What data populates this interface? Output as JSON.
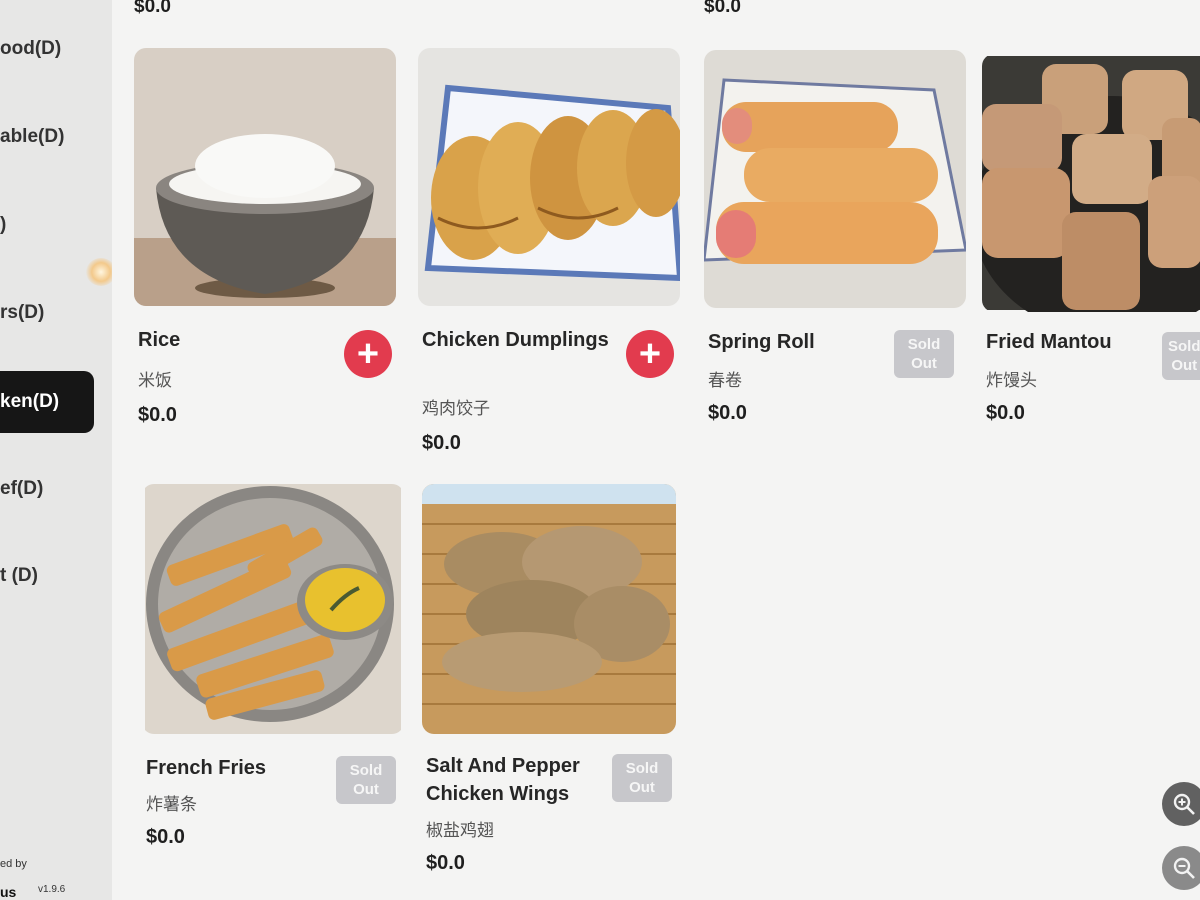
{
  "sidebar": {
    "categories": [
      {
        "label": "ood(D)"
      },
      {
        "label": "able(D)"
      },
      {
        "label": ")"
      },
      {
        "label": "rs(D)"
      },
      {
        "label": "ken(D)"
      },
      {
        "label": "ef(D)"
      },
      {
        "label": "t (D)"
      }
    ],
    "active_index": 4,
    "powered_label": "ed by",
    "brand": "us",
    "version": "v1.9.6"
  },
  "top_row_prices": [
    "$0.0",
    "$0.0"
  ],
  "items": [
    {
      "name": "Rice",
      "chinese": "米饭",
      "price": "$0.0",
      "status": "add",
      "image": "rice-bowl"
    },
    {
      "name": "Chicken Dumplings",
      "chinese": "鸡肉饺子",
      "price": "$0.0",
      "status": "add",
      "image": "pan-fried-dumplings"
    },
    {
      "name": "Spring Roll",
      "chinese": "春卷",
      "price": "$0.0",
      "status": "sold_out",
      "image": "spring-rolls"
    },
    {
      "name": "Fried Mantou",
      "chinese": "炸馒头",
      "price": "$0.0",
      "status": "sold_out",
      "image": "fried-buns"
    },
    {
      "name": "French Fries",
      "chinese": "炸薯条",
      "price": "$0.0",
      "status": "sold_out",
      "image": "fries-with-dip"
    },
    {
      "name": "Salt And Pepper Chicken Wings",
      "chinese": "椒盐鸡翅",
      "price": "$0.0",
      "status": "sold_out",
      "image": "fried-chicken-wings"
    }
  ],
  "labels": {
    "add": "+",
    "sold_out_line1": "Sold",
    "sold_out_line2": "Out"
  },
  "icons": [
    "plus-icon",
    "zoom-in-icon",
    "zoom-out-icon"
  ],
  "colors": {
    "accent": "#e23b4e",
    "active_category": "#161616",
    "sold_out": "#c7c7cb"
  }
}
